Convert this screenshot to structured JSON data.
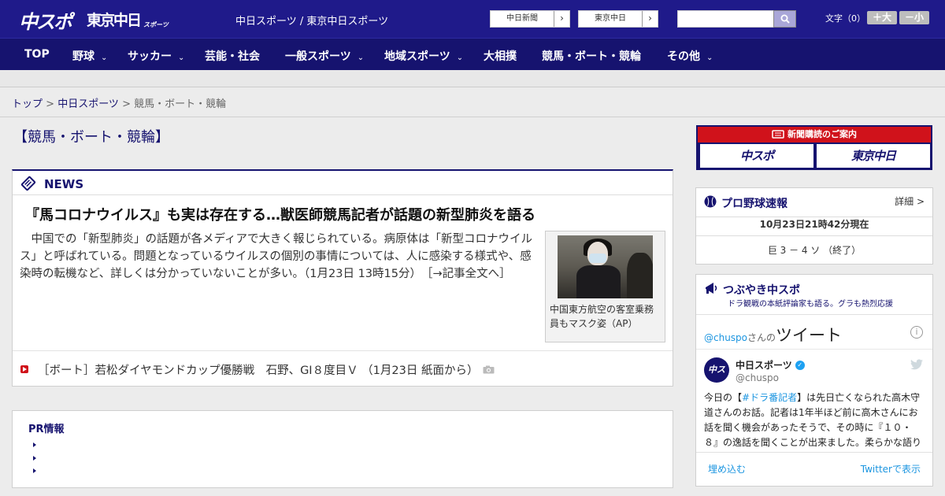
{
  "header": {
    "logo_main": "中スポ",
    "logo_tokyo": "東京中日",
    "logo_tokyo_sub": "スポーツ",
    "sites_text": "中日スポーツ / 東京中日スポーツ",
    "site_buttons": [
      "中日新聞",
      "東京中日"
    ],
    "fontsize_label": "文字（0）",
    "fontsize_plus": "＋大",
    "fontsize_minus": "－小"
  },
  "nav": {
    "items": [
      {
        "label": "TOP"
      },
      {
        "label": "野球",
        "chevron": "⌄"
      },
      {
        "label": "サッカー",
        "chevron": "⌄"
      },
      {
        "label": "芸能・社会"
      },
      {
        "label": "一般スポーツ",
        "chevron": "⌄"
      },
      {
        "label": "地域スポーツ",
        "chevron": "⌄"
      },
      {
        "label": "大相撲"
      },
      {
        "label": "競馬・ボート・競輪"
      },
      {
        "label": "その他",
        "chevron": "⌄"
      }
    ]
  },
  "breadcrumb": {
    "home": "トップ",
    "sep": " > ",
    "section": "中日スポーツ",
    "current": "競馬・ボート・競輪"
  },
  "page_title": "【競馬・ボート・競輪】",
  "news": {
    "label": "NEWS",
    "headline": "『馬コロナウイルス』も実は存在する…獣医師競馬記者が話題の新型肺炎を語る",
    "body": "中国での「新型肺炎」の話題が各メディアで大きく報じられている。病原体は「新型コロナウイルス」と呼ばれている。問題となっているウイルスの個別の事情については、人に感染する様式や、感染時の転機など、詳しくは分かっていないことが多い。（1月23日 13時15分）",
    "more": "［→記事全文へ］",
    "photo_caption": "中国東方航空の客室乗務員もマスク姿（AP）",
    "sub_item": "［ボート］若松ダイヤモンドカップ優勝戦　石野、GⅠ８度目Ｖ （1月23日 紙面から）"
  },
  "pr": {
    "title": "PR情報"
  },
  "subscription": {
    "top": "新聞購読のご案内",
    "logo_left": "中スポ",
    "logo_right": "東京中日"
  },
  "baseball": {
    "title": "プロ野球速報",
    "detail": "詳細 >",
    "time": "10月23日21時42分現在",
    "score": "巨 3 － 4 ソ （終了）"
  },
  "tweets": {
    "title": "つぶやき中スポ",
    "subtitle": "ドラ観戦の本紙評論家も語る。グラも熱烈応援",
    "header_handle": "@chuspo",
    "header_san": "さんの",
    "header_big": "ツイート",
    "info": "i",
    "avatar": "中スポ",
    "account_name": "中日スポーツ",
    "account_handle": "@chuspo",
    "text_before": "今日の【",
    "text_tag": "#ドラ番記者",
    "text_after": "】は先日亡くなられた高木守道さんのお話。記者は1年半ほど前に高木さんにお話を聞く機会があったそうで、その時に『１０・８』の逸話を聞くことが出来ました。柔らかな語り",
    "embed": "埋め込む",
    "view_on_twitter": "Twitterで表示"
  },
  "colors": {
    "brand": "#1f1a8a",
    "nav": "#16136f",
    "accent_red": "#d0121b",
    "twitter_blue": "#1b95e0"
  }
}
